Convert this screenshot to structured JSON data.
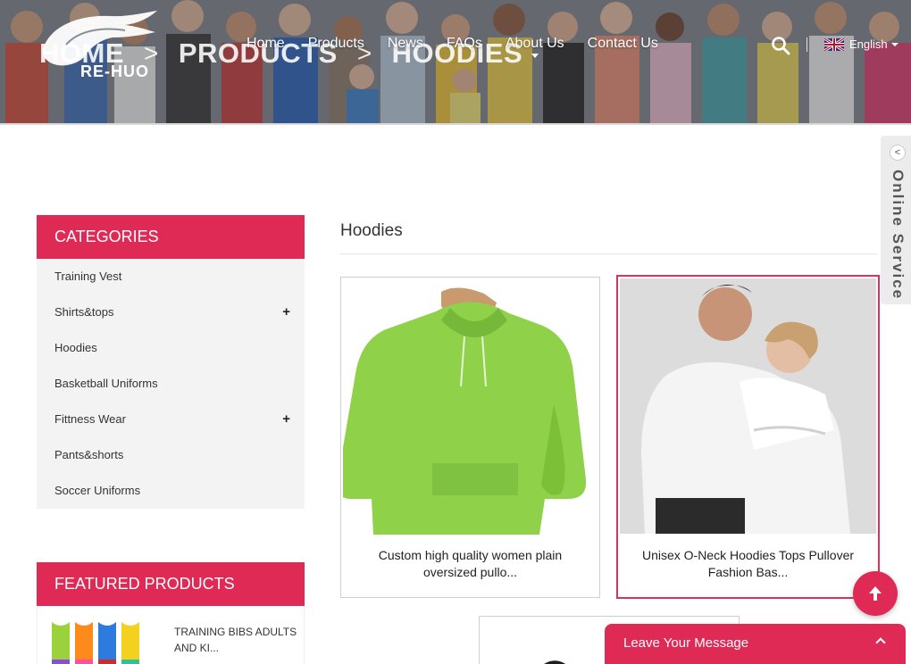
{
  "header": {
    "breadcrumb": [
      "HOME",
      ">",
      "PRODUCTS",
      ">",
      "HOODIES"
    ],
    "logo_text": "RE-HUO",
    "nav": [
      "Home",
      "Products",
      "News",
      "FAQs",
      "About Us",
      "Contact Us"
    ],
    "language": "English",
    "icons": {
      "search": "search-icon",
      "flag": "uk-flag-icon"
    }
  },
  "sidebar": {
    "categories_title": "CATEGORIES",
    "categories": [
      {
        "label": "Training Vest",
        "expand": ""
      },
      {
        "label": "Shirts&tops",
        "expand": "+"
      },
      {
        "label": "Hoodies",
        "expand": ""
      },
      {
        "label": "Basketball Uniforms",
        "expand": ""
      },
      {
        "label": "Fittness Wear",
        "expand": "+"
      },
      {
        "label": "Pants&shorts",
        "expand": ""
      },
      {
        "label": "Soccer Uniforms",
        "expand": ""
      }
    ],
    "featured_title": "FEATURED PRODUCTS",
    "featured": [
      {
        "title": "TRAINING BIBS ADULTS AND KI..."
      }
    ]
  },
  "main": {
    "title": "Hoodies",
    "products": [
      {
        "caption": "Custom high quality women plain oversized pullo..."
      },
      {
        "caption": "Unisex O-Neck Hoodies Tops Pullover Fashion Bas..."
      }
    ]
  },
  "widgets": {
    "online_service": "Online Service",
    "online_chevron": "<",
    "leave_message": "Leave Your Message"
  },
  "colors": {
    "accent": "#df2a55",
    "sidebar_bg": "#f3f3f3"
  }
}
